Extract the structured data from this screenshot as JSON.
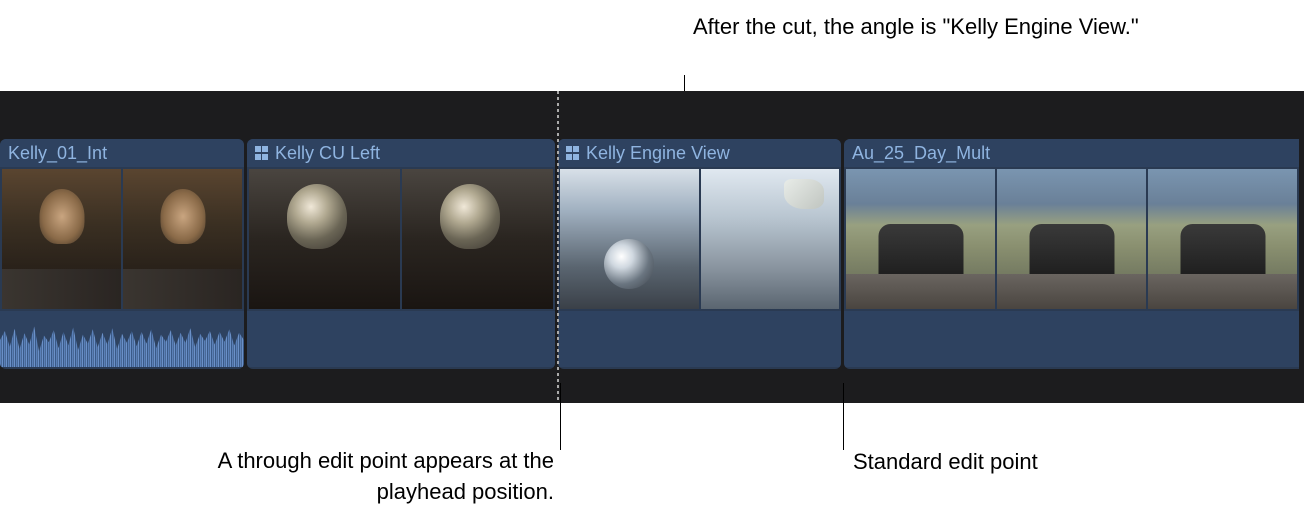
{
  "annotations": {
    "top": "After the cut, the angle is \"Kelly Engine View.\"",
    "bottom_left": "A through edit point appears at the playhead position.",
    "bottom_right": "Standard edit point"
  },
  "timeline": {
    "clips": [
      {
        "name": "Kelly_01_Int",
        "is_multicam": false,
        "has_waveform": true
      },
      {
        "name": "Kelly CU Left",
        "is_multicam": true,
        "has_waveform": false
      },
      {
        "name": "Kelly Engine View",
        "is_multicam": true,
        "has_waveform": false
      },
      {
        "name": "Au_25_Day_Mult",
        "is_multicam": false,
        "has_waveform": false
      }
    ]
  }
}
